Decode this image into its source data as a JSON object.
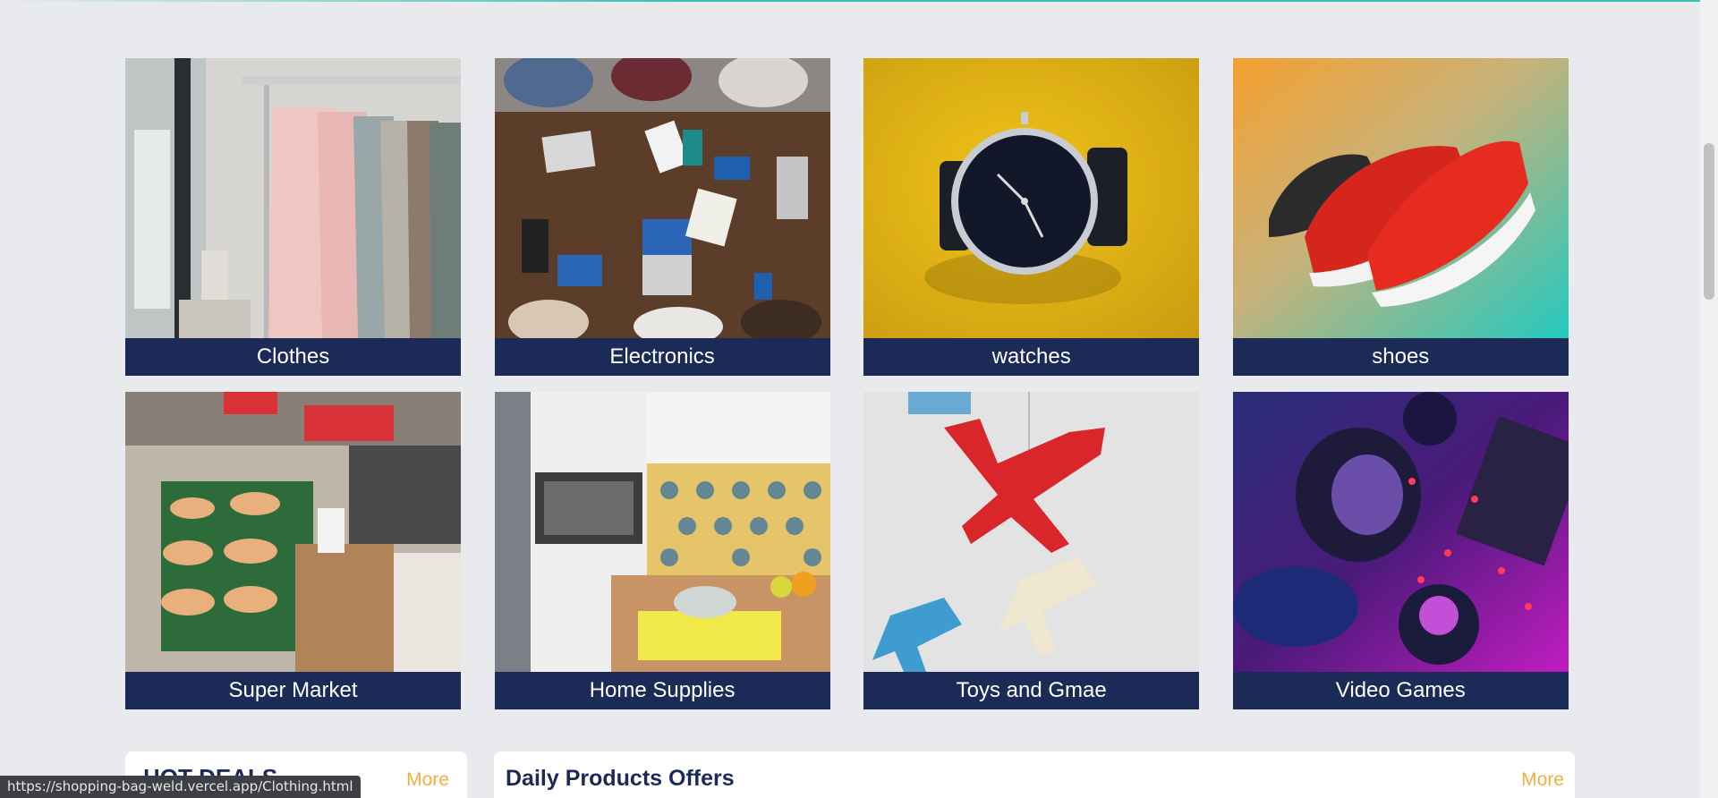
{
  "categories": [
    {
      "label": "Clothes",
      "icon": "clothes-rack-image"
    },
    {
      "label": "Electronics",
      "icon": "electronics-table-image"
    },
    {
      "label": "watches",
      "icon": "wristwatch-image"
    },
    {
      "label": "shoes",
      "icon": "sneakers-image"
    },
    {
      "label": "Super Market",
      "icon": "supermarket-image"
    },
    {
      "label": "Home Supplies",
      "icon": "kitchen-image"
    },
    {
      "label": "Toys and Gmae",
      "icon": "toy-planes-image"
    },
    {
      "label": "Video Games",
      "icon": "gaming-gear-image"
    }
  ],
  "hot_deals": {
    "title": "HOT DEALS",
    "more": "More"
  },
  "daily_offers": {
    "title": "Daily Products Offers",
    "more": "More"
  },
  "status_bar": {
    "url": "https://shopping-bag-weld.vercel.app/Clothing.html"
  },
  "colors": {
    "background": "#e9eaee",
    "caption_bg": "#1b2a57",
    "more_link": "#f0b040",
    "accent_line": "#3bbfb3"
  }
}
